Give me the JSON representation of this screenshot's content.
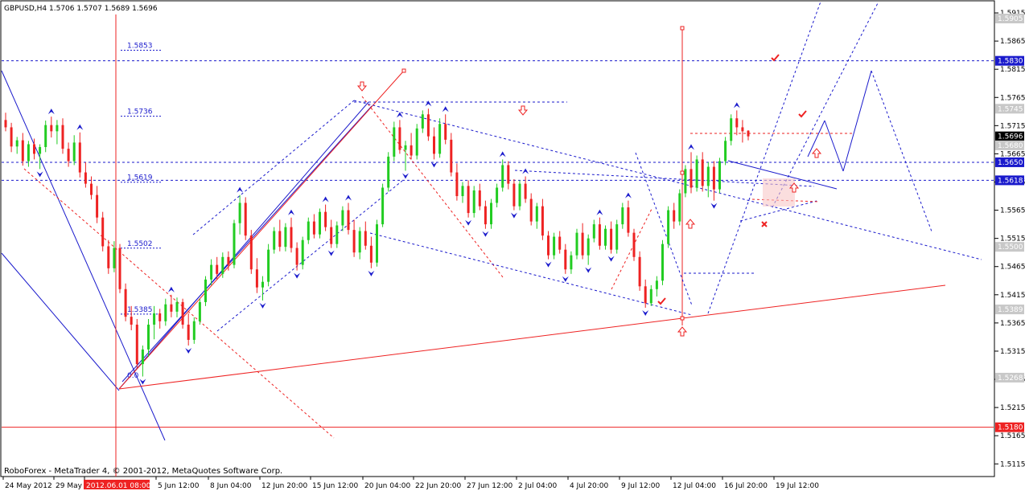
{
  "header": {
    "text": "GBPUSD,H4  1.5706 1.5707 1.5689 1.5696"
  },
  "footer": {
    "copyright": "RoboForex - MetaTrader 4, © 2001-2012, MetaQuotes Software Corp."
  },
  "colors": {
    "background": "#ffffff",
    "bull": "#22cc22",
    "bear": "#ee2222",
    "wave_line": "#1a1acc",
    "resistance": "#ee2222",
    "grid": "#c0c0c0",
    "box_dark": "#000000",
    "box_blue": "#1a1acc",
    "box_gray": "#c8c8c8",
    "box_red": "#ee2222"
  },
  "chart_data": {
    "type": "candlestick",
    "symbol": "GBPUSD",
    "timeframe": "H4",
    "ohlc_current": {
      "open": 1.5706,
      "high": 1.5707,
      "low": 1.5689,
      "close": 1.5696
    },
    "y_range": [
      1.5094,
      1.5935
    ],
    "x_labels": [
      "24 May 2012",
      "29 May",
      "2012.06.01 08:00",
      "5 Jun 12:00",
      "8 Jun 04:00",
      "12 Jun 20:00",
      "15 Jun 12:00",
      "20 Jun 04:00",
      "22 Jun 20:00",
      "27 Jun 12:00",
      "2 Jul 04:00",
      "4 Jul 20:00",
      "9 Jul 12:00",
      "12 Jul 04:00",
      "16 Jul 20:00",
      "19 Jul 12:00"
    ],
    "y_ticks": [
      "1.5915",
      "1.5865",
      "1.5815",
      "1.5765",
      "1.5715",
      "1.5665",
      "1.5615",
      "1.5565",
      "1.5515",
      "1.5465",
      "1.5415",
      "1.5365",
      "1.5315",
      "1.5265",
      "1.5215",
      "1.5165",
      "1.5115"
    ],
    "price_boxes": [
      {
        "text": "1.5905",
        "style": "gray",
        "price": 1.5905
      },
      {
        "text": "1.5830",
        "style": "blue",
        "price": 1.583
      },
      {
        "text": "1.5745",
        "style": "gray",
        "price": 1.5745
      },
      {
        "text": "1.5696",
        "style": "dark",
        "price": 1.5696
      },
      {
        "text": "1.5680",
        "style": "gray",
        "price": 1.568
      },
      {
        "text": "1.5650",
        "style": "blue",
        "price": 1.565
      },
      {
        "text": "1.5618",
        "style": "blue",
        "price": 1.5618
      },
      {
        "text": "1.5500",
        "style": "gray",
        "price": 1.55
      },
      {
        "text": "1.5389",
        "style": "gray",
        "price": 1.5389
      },
      {
        "text": "1.5268",
        "style": "gray",
        "price": 1.5268
      },
      {
        "text": "1.5180",
        "style": "red",
        "price": 1.518
      }
    ],
    "fib_levels": [
      {
        "label": "1.5853",
        "price": 1.5853
      },
      {
        "label": "1.5736",
        "price": 1.5736
      },
      {
        "label": "1.5619",
        "price": 1.5619
      },
      {
        "label": "1.5502",
        "price": 1.5502
      },
      {
        "label": "1.5385",
        "price": 1.5385
      },
      {
        "label": "0.0",
        "price": 1.5268
      }
    ],
    "horizontal_lines": [
      {
        "price": 1.583,
        "style": "dash",
        "color": "blue"
      },
      {
        "price": 1.565,
        "style": "dash",
        "color": "blue"
      },
      {
        "price": 1.5618,
        "style": "dash",
        "color": "blue"
      },
      {
        "price": 1.518,
        "style": "solid",
        "color": "red"
      }
    ],
    "candles": [
      {
        "o": 1.5725,
        "h": 1.5738,
        "l": 1.5705,
        "c": 1.5712
      },
      {
        "o": 1.5712,
        "h": 1.572,
        "l": 1.5668,
        "c": 1.5678
      },
      {
        "o": 1.5678,
        "h": 1.5695,
        "l": 1.5665,
        "c": 1.5689
      },
      {
        "o": 1.5689,
        "h": 1.5702,
        "l": 1.5644,
        "c": 1.5652
      },
      {
        "o": 1.5652,
        "h": 1.5688,
        "l": 1.5642,
        "c": 1.5682
      },
      {
        "o": 1.5682,
        "h": 1.5692,
        "l": 1.5655,
        "c": 1.5665
      },
      {
        "o": 1.5665,
        "h": 1.5682,
        "l": 1.5638,
        "c": 1.5677
      },
      {
        "o": 1.5677,
        "h": 1.5724,
        "l": 1.5668,
        "c": 1.5716
      },
      {
        "o": 1.5716,
        "h": 1.5731,
        "l": 1.5694,
        "c": 1.5705
      },
      {
        "o": 1.5705,
        "h": 1.5725,
        "l": 1.5682,
        "c": 1.5716
      },
      {
        "o": 1.5716,
        "h": 1.5728,
        "l": 1.5665,
        "c": 1.5674
      },
      {
        "o": 1.5674,
        "h": 1.5685,
        "l": 1.5642,
        "c": 1.5652
      },
      {
        "o": 1.5652,
        "h": 1.5698,
        "l": 1.5645,
        "c": 1.5685
      },
      {
        "o": 1.5685,
        "h": 1.5703,
        "l": 1.5623,
        "c": 1.5632
      },
      {
        "o": 1.5632,
        "h": 1.565,
        "l": 1.5605,
        "c": 1.5612
      },
      {
        "o": 1.5612,
        "h": 1.5625,
        "l": 1.5584,
        "c": 1.5592
      },
      {
        "o": 1.5592,
        "h": 1.5608,
        "l": 1.5542,
        "c": 1.5552
      },
      {
        "o": 1.5552,
        "h": 1.5562,
        "l": 1.5492,
        "c": 1.5501
      },
      {
        "o": 1.5501,
        "h": 1.5512,
        "l": 1.5452,
        "c": 1.5462
      },
      {
        "o": 1.5462,
        "h": 1.551,
        "l": 1.5455,
        "c": 1.5498
      },
      {
        "o": 1.5498,
        "h": 1.5505,
        "l": 1.5418,
        "c": 1.5425
      },
      {
        "o": 1.5425,
        "h": 1.5435,
        "l": 1.5368,
        "c": 1.5376
      },
      {
        "o": 1.5376,
        "h": 1.5395,
        "l": 1.5352,
        "c": 1.5362
      },
      {
        "o": 1.5362,
        "h": 1.5372,
        "l": 1.5285,
        "c": 1.5292
      },
      {
        "o": 1.5292,
        "h": 1.5325,
        "l": 1.527,
        "c": 1.5318
      },
      {
        "o": 1.5318,
        "h": 1.5372,
        "l": 1.5305,
        "c": 1.5362
      },
      {
        "o": 1.5362,
        "h": 1.5395,
        "l": 1.5336,
        "c": 1.5382
      },
      {
        "o": 1.5382,
        "h": 1.539,
        "l": 1.5355,
        "c": 1.5368
      },
      {
        "o": 1.5368,
        "h": 1.5408,
        "l": 1.536,
        "c": 1.5398
      },
      {
        "o": 1.5398,
        "h": 1.5415,
        "l": 1.5375,
        "c": 1.5385
      },
      {
        "o": 1.5385,
        "h": 1.541,
        "l": 1.5375,
        "c": 1.5402
      },
      {
        "o": 1.5402,
        "h": 1.5408,
        "l": 1.5355,
        "c": 1.5362
      },
      {
        "o": 1.5362,
        "h": 1.5382,
        "l": 1.5325,
        "c": 1.5335
      },
      {
        "o": 1.5335,
        "h": 1.5375,
        "l": 1.5328,
        "c": 1.5368
      },
      {
        "o": 1.5368,
        "h": 1.5408,
        "l": 1.5362,
        "c": 1.5402
      },
      {
        "o": 1.5402,
        "h": 1.5448,
        "l": 1.5395,
        "c": 1.5442
      },
      {
        "o": 1.5442,
        "h": 1.5478,
        "l": 1.5432,
        "c": 1.5468
      },
      {
        "o": 1.5468,
        "h": 1.5482,
        "l": 1.5442,
        "c": 1.5452
      },
      {
        "o": 1.5452,
        "h": 1.549,
        "l": 1.5445,
        "c": 1.5482
      },
      {
        "o": 1.5482,
        "h": 1.5492,
        "l": 1.5458,
        "c": 1.5468
      },
      {
        "o": 1.5468,
        "h": 1.5548,
        "l": 1.5462,
        "c": 1.5542
      },
      {
        "o": 1.5542,
        "h": 1.5592,
        "l": 1.5522,
        "c": 1.5578
      },
      {
        "o": 1.5578,
        "h": 1.5588,
        "l": 1.5512,
        "c": 1.552
      },
      {
        "o": 1.552,
        "h": 1.553,
        "l": 1.5452,
        "c": 1.546
      },
      {
        "o": 1.546,
        "h": 1.548,
        "l": 1.5418,
        "c": 1.5428
      },
      {
        "o": 1.5428,
        "h": 1.5448,
        "l": 1.5405,
        "c": 1.5438
      },
      {
        "o": 1.5438,
        "h": 1.5505,
        "l": 1.543,
        "c": 1.5495
      },
      {
        "o": 1.5495,
        "h": 1.5535,
        "l": 1.5488,
        "c": 1.5528
      },
      {
        "o": 1.5528,
        "h": 1.5548,
        "l": 1.5492,
        "c": 1.55
      },
      {
        "o": 1.55,
        "h": 1.5542,
        "l": 1.5492,
        "c": 1.5535
      },
      {
        "o": 1.5535,
        "h": 1.5552,
        "l": 1.549,
        "c": 1.5498
      },
      {
        "o": 1.5498,
        "h": 1.5508,
        "l": 1.5458,
        "c": 1.5468
      },
      {
        "o": 1.5468,
        "h": 1.5518,
        "l": 1.546,
        "c": 1.5512
      },
      {
        "o": 1.5512,
        "h": 1.5552,
        "l": 1.5505,
        "c": 1.5545
      },
      {
        "o": 1.5545,
        "h": 1.5558,
        "l": 1.5515,
        "c": 1.5522
      },
      {
        "o": 1.5522,
        "h": 1.5568,
        "l": 1.5515,
        "c": 1.5562
      },
      {
        "o": 1.5562,
        "h": 1.5575,
        "l": 1.5528,
        "c": 1.5535
      },
      {
        "o": 1.5535,
        "h": 1.5548,
        "l": 1.5498,
        "c": 1.5505
      },
      {
        "o": 1.5505,
        "h": 1.5545,
        "l": 1.5498,
        "c": 1.5538
      },
      {
        "o": 1.5538,
        "h": 1.5572,
        "l": 1.5528,
        "c": 1.5565
      },
      {
        "o": 1.5565,
        "h": 1.5578,
        "l": 1.5522,
        "c": 1.553
      },
      {
        "o": 1.553,
        "h": 1.5548,
        "l": 1.5482,
        "c": 1.549
      },
      {
        "o": 1.549,
        "h": 1.5535,
        "l": 1.5478,
        "c": 1.5528
      },
      {
        "o": 1.5528,
        "h": 1.5545,
        "l": 1.5495,
        "c": 1.5502
      },
      {
        "o": 1.5502,
        "h": 1.5518,
        "l": 1.5462,
        "c": 1.5472
      },
      {
        "o": 1.5472,
        "h": 1.5548,
        "l": 1.5465,
        "c": 1.554
      },
      {
        "o": 1.554,
        "h": 1.5612,
        "l": 1.5535,
        "c": 1.5605
      },
      {
        "o": 1.5605,
        "h": 1.5668,
        "l": 1.5598,
        "c": 1.566
      },
      {
        "o": 1.566,
        "h": 1.5722,
        "l": 1.5652,
        "c": 1.5712
      },
      {
        "o": 1.5712,
        "h": 1.5725,
        "l": 1.5665,
        "c": 1.5672
      },
      {
        "o": 1.5672,
        "h": 1.5688,
        "l": 1.5635,
        "c": 1.568
      },
      {
        "o": 1.568,
        "h": 1.5702,
        "l": 1.5655,
        "c": 1.5662
      },
      {
        "o": 1.5662,
        "h": 1.5718,
        "l": 1.5655,
        "c": 1.571
      },
      {
        "o": 1.571,
        "h": 1.5742,
        "l": 1.5702,
        "c": 1.5735
      },
      {
        "o": 1.5735,
        "h": 1.5745,
        "l": 1.5688,
        "c": 1.5696
      },
      {
        "o": 1.5696,
        "h": 1.5712,
        "l": 1.5655,
        "c": 1.5665
      },
      {
        "o": 1.5665,
        "h": 1.5728,
        "l": 1.5658,
        "c": 1.5718
      },
      {
        "o": 1.5718,
        "h": 1.5735,
        "l": 1.5682,
        "c": 1.569
      },
      {
        "o": 1.569,
        "h": 1.5702,
        "l": 1.5625,
        "c": 1.5632
      },
      {
        "o": 1.5632,
        "h": 1.5648,
        "l": 1.5582,
        "c": 1.559
      },
      {
        "o": 1.559,
        "h": 1.5615,
        "l": 1.5578,
        "c": 1.5608
      },
      {
        "o": 1.5608,
        "h": 1.5618,
        "l": 1.5552,
        "c": 1.556
      },
      {
        "o": 1.556,
        "h": 1.5608,
        "l": 1.5552,
        "c": 1.56
      },
      {
        "o": 1.56,
        "h": 1.5612,
        "l": 1.5565,
        "c": 1.5572
      },
      {
        "o": 1.5572,
        "h": 1.5582,
        "l": 1.5532,
        "c": 1.554
      },
      {
        "o": 1.554,
        "h": 1.5585,
        "l": 1.5532,
        "c": 1.5578
      },
      {
        "o": 1.5578,
        "h": 1.5612,
        "l": 1.557,
        "c": 1.5605
      },
      {
        "o": 1.5605,
        "h": 1.5655,
        "l": 1.5598,
        "c": 1.5645
      },
      {
        "o": 1.5645,
        "h": 1.5652,
        "l": 1.5602,
        "c": 1.5612
      },
      {
        "o": 1.5612,
        "h": 1.562,
        "l": 1.5565,
        "c": 1.5572
      },
      {
        "o": 1.5572,
        "h": 1.5618,
        "l": 1.5565,
        "c": 1.5612
      },
      {
        "o": 1.5612,
        "h": 1.5625,
        "l": 1.5578,
        "c": 1.5585
      },
      {
        "o": 1.5585,
        "h": 1.5595,
        "l": 1.5538,
        "c": 1.5545
      },
      {
        "o": 1.5545,
        "h": 1.5578,
        "l": 1.5532,
        "c": 1.5572
      },
      {
        "o": 1.5572,
        "h": 1.5585,
        "l": 1.5512,
        "c": 1.552
      },
      {
        "o": 1.552,
        "h": 1.5528,
        "l": 1.5478,
        "c": 1.5485
      },
      {
        "o": 1.5485,
        "h": 1.5525,
        "l": 1.5478,
        "c": 1.5518
      },
      {
        "o": 1.5518,
        "h": 1.5528,
        "l": 1.5488,
        "c": 1.5495
      },
      {
        "o": 1.5495,
        "h": 1.5505,
        "l": 1.5452,
        "c": 1.546
      },
      {
        "o": 1.546,
        "h": 1.5492,
        "l": 1.5452,
        "c": 1.5485
      },
      {
        "o": 1.5485,
        "h": 1.5532,
        "l": 1.5478,
        "c": 1.5525
      },
      {
        "o": 1.5525,
        "h": 1.5542,
        "l": 1.5478,
        "c": 1.5485
      },
      {
        "o": 1.5485,
        "h": 1.5522,
        "l": 1.5468,
        "c": 1.5515
      },
      {
        "o": 1.5515,
        "h": 1.5548,
        "l": 1.5508,
        "c": 1.554
      },
      {
        "o": 1.554,
        "h": 1.5552,
        "l": 1.5495,
        "c": 1.5502
      },
      {
        "o": 1.5502,
        "h": 1.5538,
        "l": 1.5495,
        "c": 1.5532
      },
      {
        "o": 1.5532,
        "h": 1.5545,
        "l": 1.5488,
        "c": 1.5495
      },
      {
        "o": 1.5495,
        "h": 1.5548,
        "l": 1.5488,
        "c": 1.554
      },
      {
        "o": 1.554,
        "h": 1.5578,
        "l": 1.5532,
        "c": 1.557
      },
      {
        "o": 1.557,
        "h": 1.5582,
        "l": 1.5518,
        "c": 1.5525
      },
      {
        "o": 1.5525,
        "h": 1.5532,
        "l": 1.5475,
        "c": 1.5482
      },
      {
        "o": 1.5482,
        "h": 1.5492,
        "l": 1.5422,
        "c": 1.543
      },
      {
        "o": 1.543,
        "h": 1.5442,
        "l": 1.5392,
        "c": 1.54
      },
      {
        "o": 1.54,
        "h": 1.5432,
        "l": 1.5395,
        "c": 1.5425
      },
      {
        "o": 1.5425,
        "h": 1.5448,
        "l": 1.5412,
        "c": 1.544
      },
      {
        "o": 1.544,
        "h": 1.5512,
        "l": 1.5432,
        "c": 1.5505
      },
      {
        "o": 1.5505,
        "h": 1.5572,
        "l": 1.5498,
        "c": 1.5565
      },
      {
        "o": 1.5565,
        "h": 1.5578,
        "l": 1.5532,
        "c": 1.5545
      },
      {
        "o": 1.5545,
        "h": 1.5602,
        "l": 1.5538,
        "c": 1.5595
      },
      {
        "o": 1.5595,
        "h": 1.5645,
        "l": 1.5588,
        "c": 1.5638
      },
      {
        "o": 1.5638,
        "h": 1.5668,
        "l": 1.5595,
        "c": 1.5605
      },
      {
        "o": 1.5605,
        "h": 1.5662,
        "l": 1.5598,
        "c": 1.5655
      },
      {
        "o": 1.5655,
        "h": 1.5668,
        "l": 1.5598,
        "c": 1.5608
      },
      {
        "o": 1.5608,
        "h": 1.565,
        "l": 1.5588,
        "c": 1.5642
      },
      {
        "o": 1.5642,
        "h": 1.5652,
        "l": 1.5582,
        "c": 1.5602
      },
      {
        "o": 1.5602,
        "h": 1.5658,
        "l": 1.5595,
        "c": 1.5652
      },
      {
        "o": 1.5652,
        "h": 1.5695,
        "l": 1.5645,
        "c": 1.5688
      },
      {
        "o": 1.5688,
        "h": 1.5735,
        "l": 1.568,
        "c": 1.5728
      },
      {
        "o": 1.5728,
        "h": 1.5742,
        "l": 1.5698,
        "c": 1.5712
      },
      {
        "o": 1.5712,
        "h": 1.5725,
        "l": 1.5685,
        "c": 1.5705
      },
      {
        "o": 1.5706,
        "h": 1.5707,
        "l": 1.5689,
        "c": 1.5696
      }
    ]
  }
}
